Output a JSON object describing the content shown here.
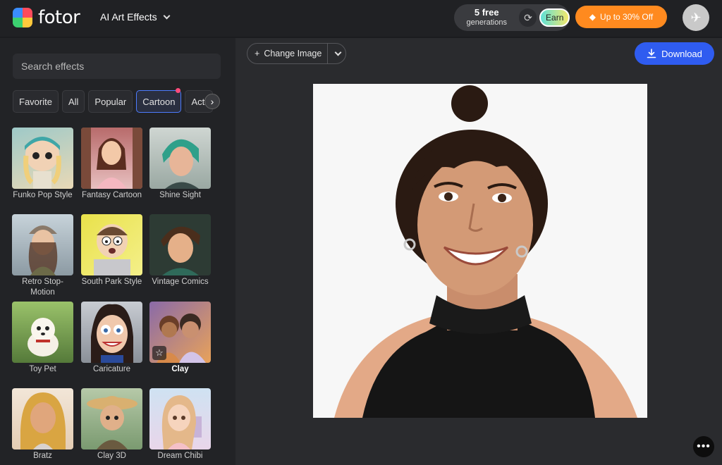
{
  "header": {
    "brand": "fotor",
    "menu_title": "AI Art Effects",
    "generations_count": "5 free",
    "generations_label": "generations",
    "earn_label": "Earn",
    "offer_label": "Up to 30% Off"
  },
  "sidebar": {
    "search_placeholder": "Search effects",
    "chips": [
      "Favorite",
      "All",
      "Popular",
      "Cartoon",
      "Acti"
    ],
    "active_chip": "Cartoon",
    "effects": [
      {
        "label": "Funko Pop Style"
      },
      {
        "label": "Fantasy Cartoon"
      },
      {
        "label": "Shine Sight"
      },
      {
        "label": "Retro Stop-Motion"
      },
      {
        "label": "South Park Style"
      },
      {
        "label": "Vintage Comics"
      },
      {
        "label": "Toy Pet"
      },
      {
        "label": "Caricature"
      },
      {
        "label": "Clay"
      },
      {
        "label": "Bratz"
      },
      {
        "label": "Clay 3D"
      },
      {
        "label": "Dream Chibi"
      }
    ]
  },
  "toolbar": {
    "change_image_label": "Change Image",
    "download_label": "Download"
  },
  "colors": {
    "accent_blue": "#2f5cf0",
    "offer_orange": "#ff8a1f",
    "active_chip_border": "#4d7cff"
  }
}
